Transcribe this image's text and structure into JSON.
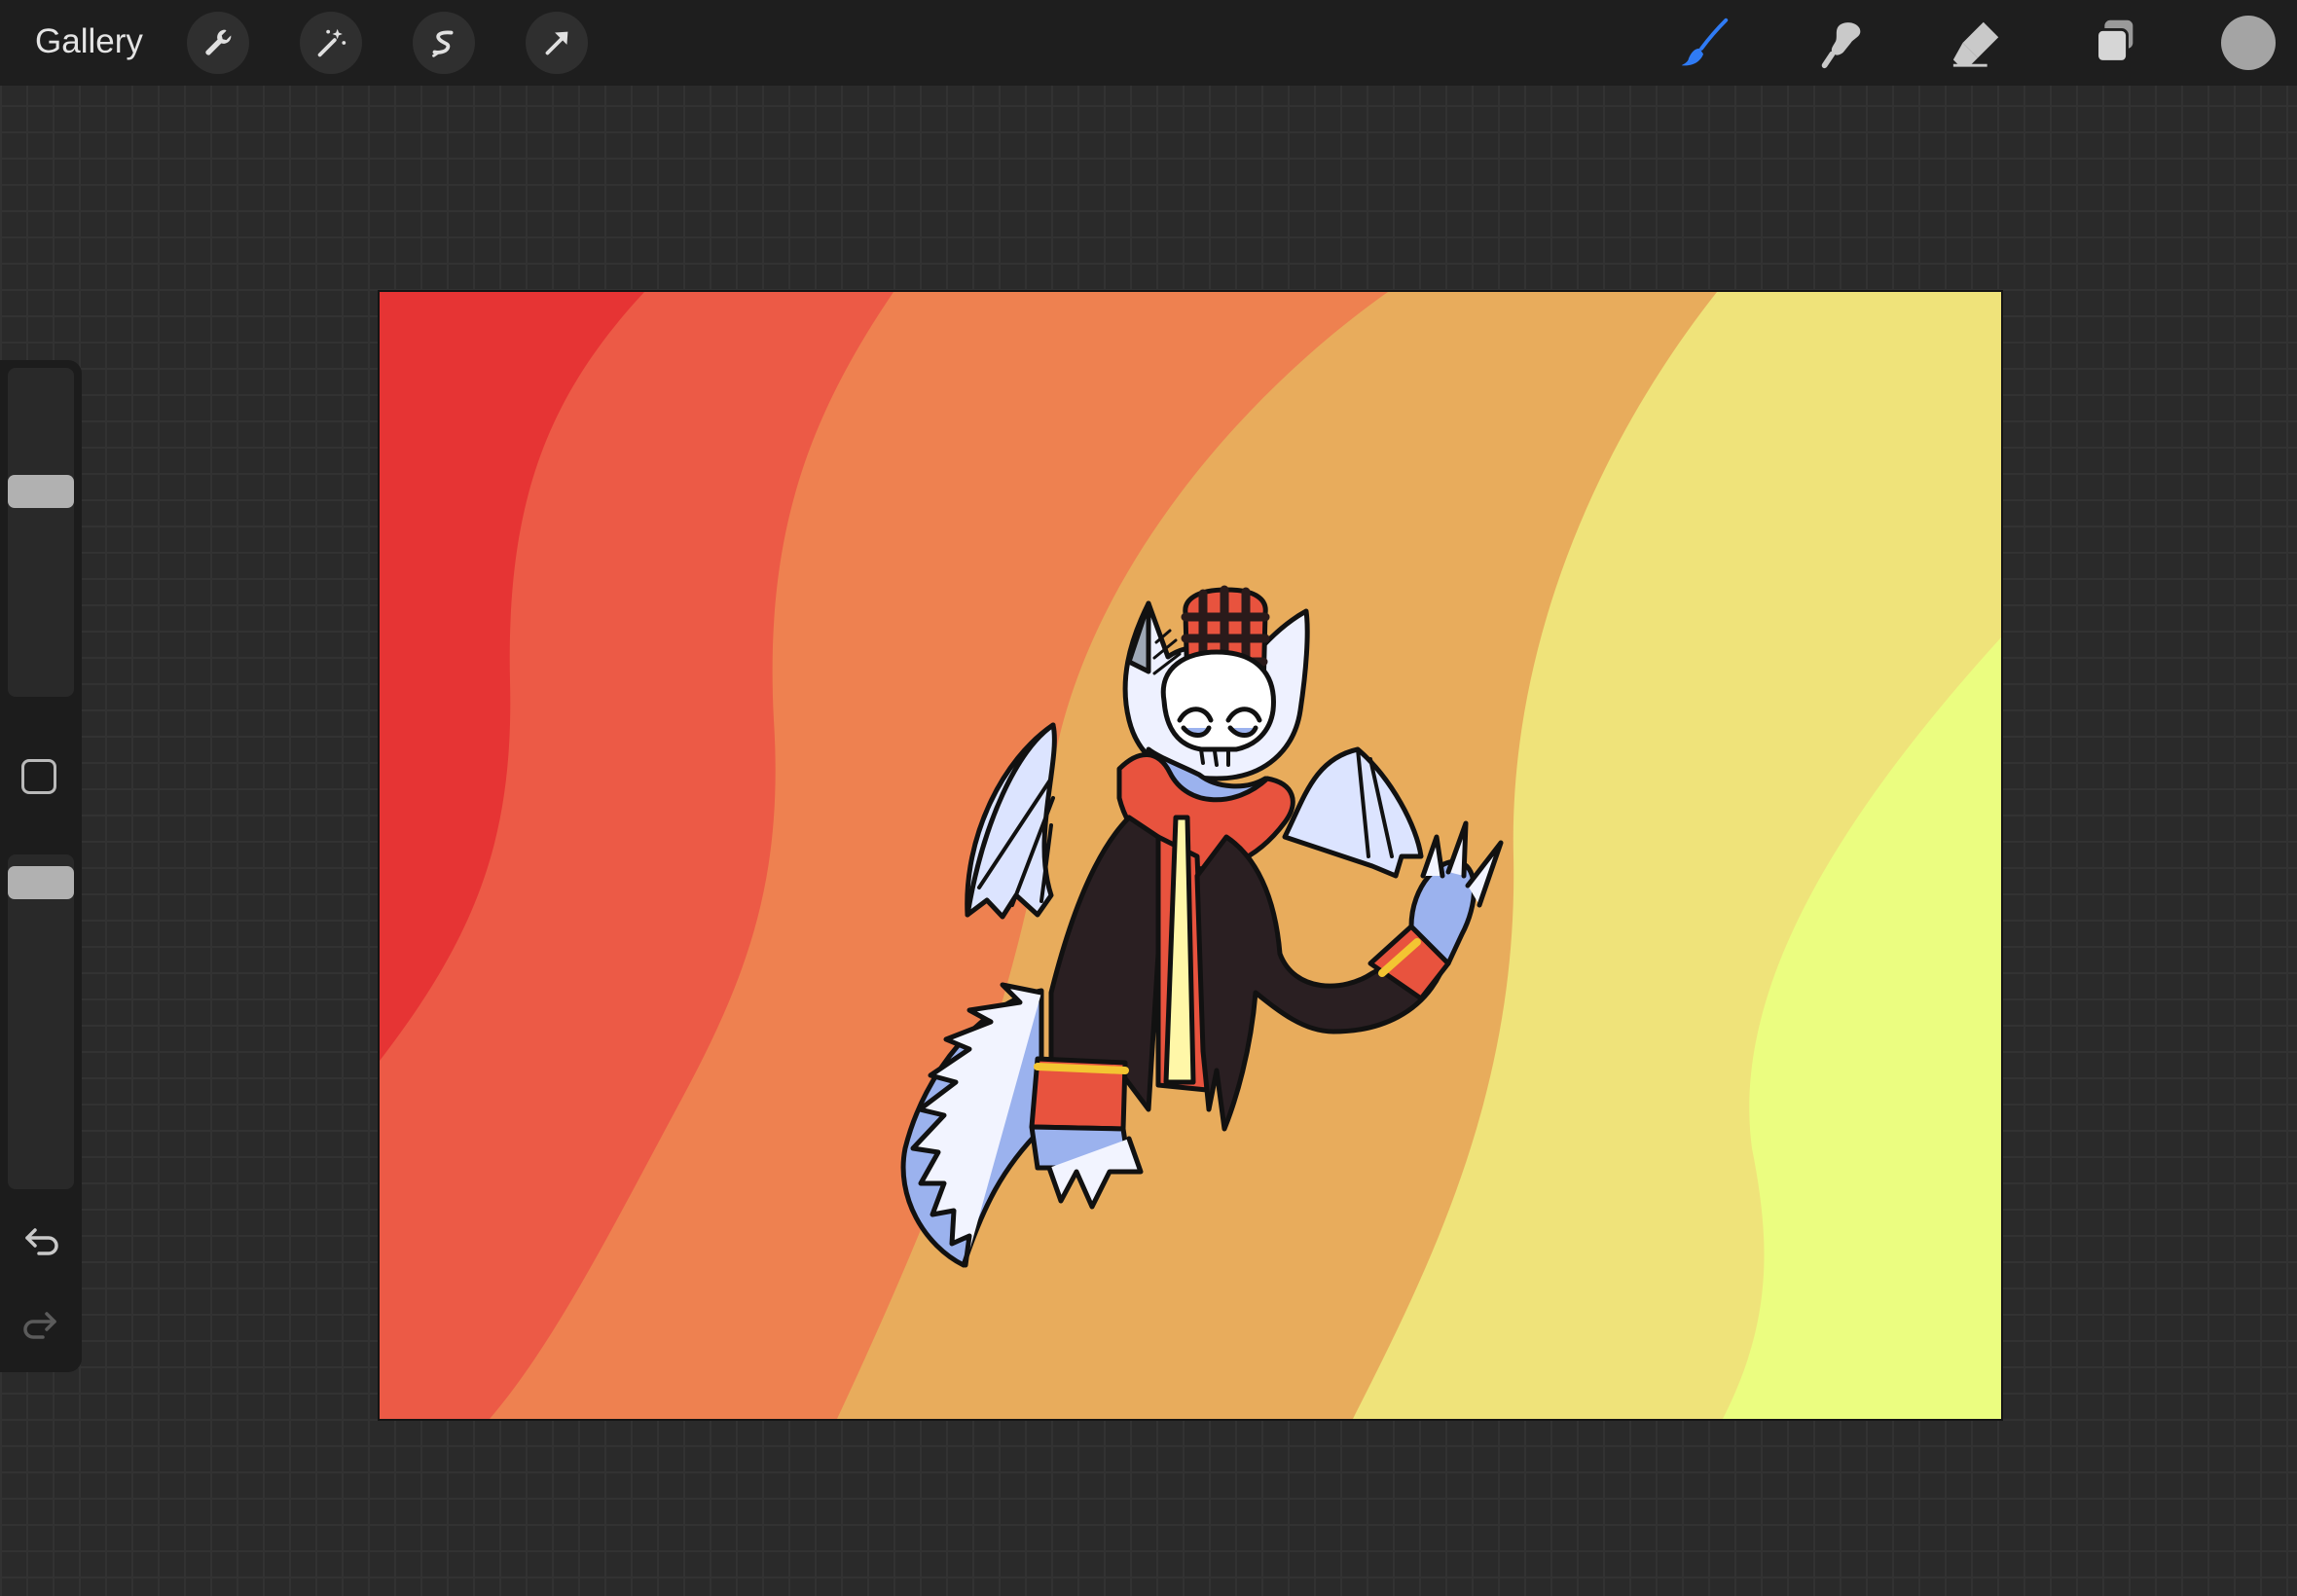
{
  "app": {
    "gallery_label": "Gallery"
  },
  "toolbar": {
    "left_tools": [
      "wrench-icon",
      "magic-wand-icon",
      "selection-s-icon",
      "transform-arrow-icon"
    ],
    "right_tools": [
      "brush-icon",
      "smudge-icon",
      "eraser-icon",
      "layers-icon"
    ],
    "active_tool": "brush",
    "accent_color": "#2f7bf5",
    "current_color": "#a4a4a4"
  },
  "sidebar": {
    "brush_size_level": 0.35,
    "opacity_level": 0.0,
    "undo_icon": "undo-arrow-icon",
    "redo_icon": "redo-arrow-icon"
  },
  "canvas": {
    "background_band_colors": [
      "#e63434",
      "#ec5a46",
      "#ee8150",
      "#e8ac5c",
      "#efe37a",
      "#ebfd80"
    ]
  }
}
